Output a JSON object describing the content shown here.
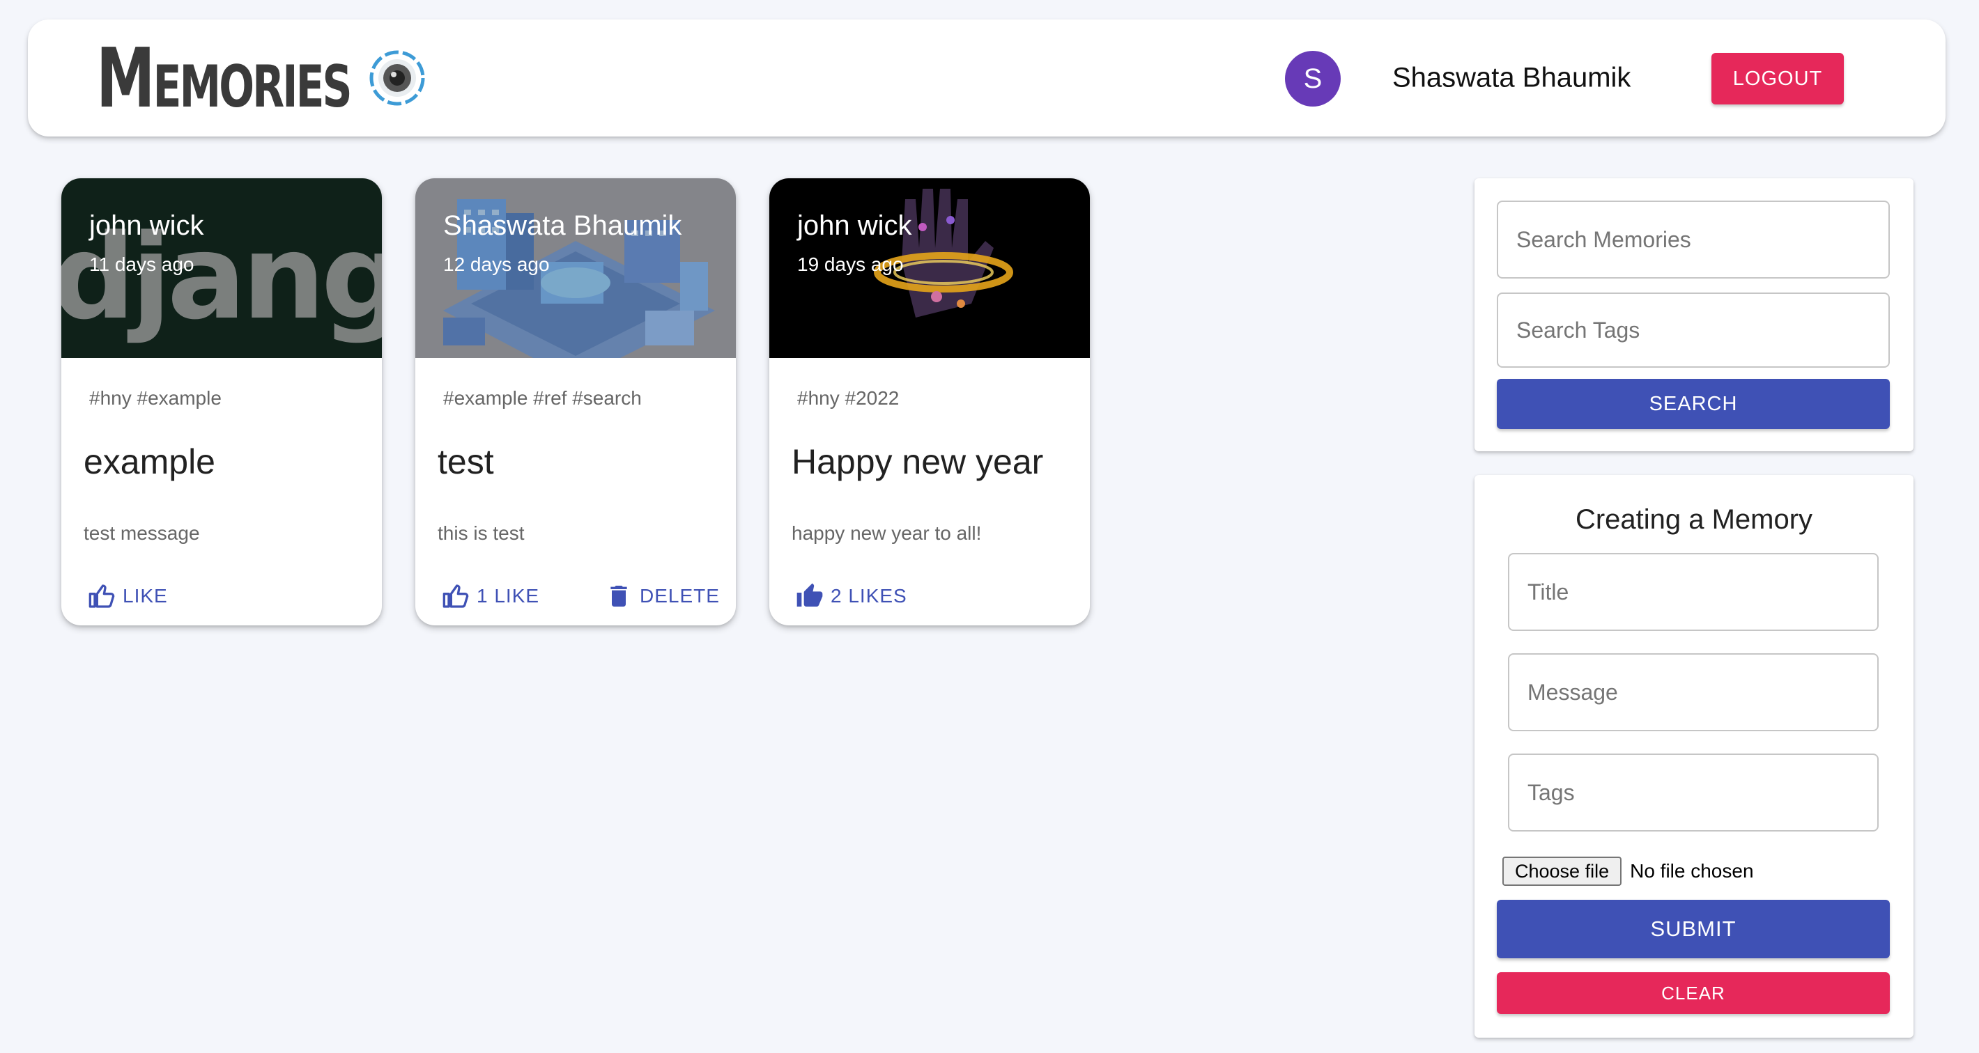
{
  "header": {
    "brand": "Memories",
    "avatar_letter": "S",
    "user_name": "Shaswata Bhaumik",
    "logout_label": "LOGOUT"
  },
  "posts": [
    {
      "author": "john wick",
      "time": "11 days ago",
      "tags": "#hny #example",
      "title": "example",
      "message": "test message",
      "like_label": "LIKE",
      "media_text": "django"
    },
    {
      "author": "Shaswata Bhaumik",
      "time": "12 days ago",
      "tags": "#example #ref #search",
      "title": "test",
      "message": "this is test",
      "like_label": "1 LIKE",
      "delete_label": "DELETE"
    },
    {
      "author": "john wick",
      "time": "19 days ago",
      "tags": "#hny #2022",
      "title": "Happy new year",
      "message": "happy new year to all!",
      "like_label": "2 LIKES"
    }
  ],
  "search": {
    "memories_placeholder": "Search Memories",
    "tags_placeholder": "Search Tags",
    "button_label": "SEARCH"
  },
  "form": {
    "heading": "Creating a Memory",
    "title_placeholder": "Title",
    "message_placeholder": "Message",
    "tags_placeholder": "Tags",
    "file_button_label": "Choose file",
    "file_status": "No file chosen",
    "submit_label": "SUBMIT",
    "clear_label": "CLEAR"
  },
  "colors": {
    "primary": "#3f51b5",
    "secondary": "#e6285a",
    "avatar": "#673ab7",
    "background": "#f4f6fb"
  }
}
